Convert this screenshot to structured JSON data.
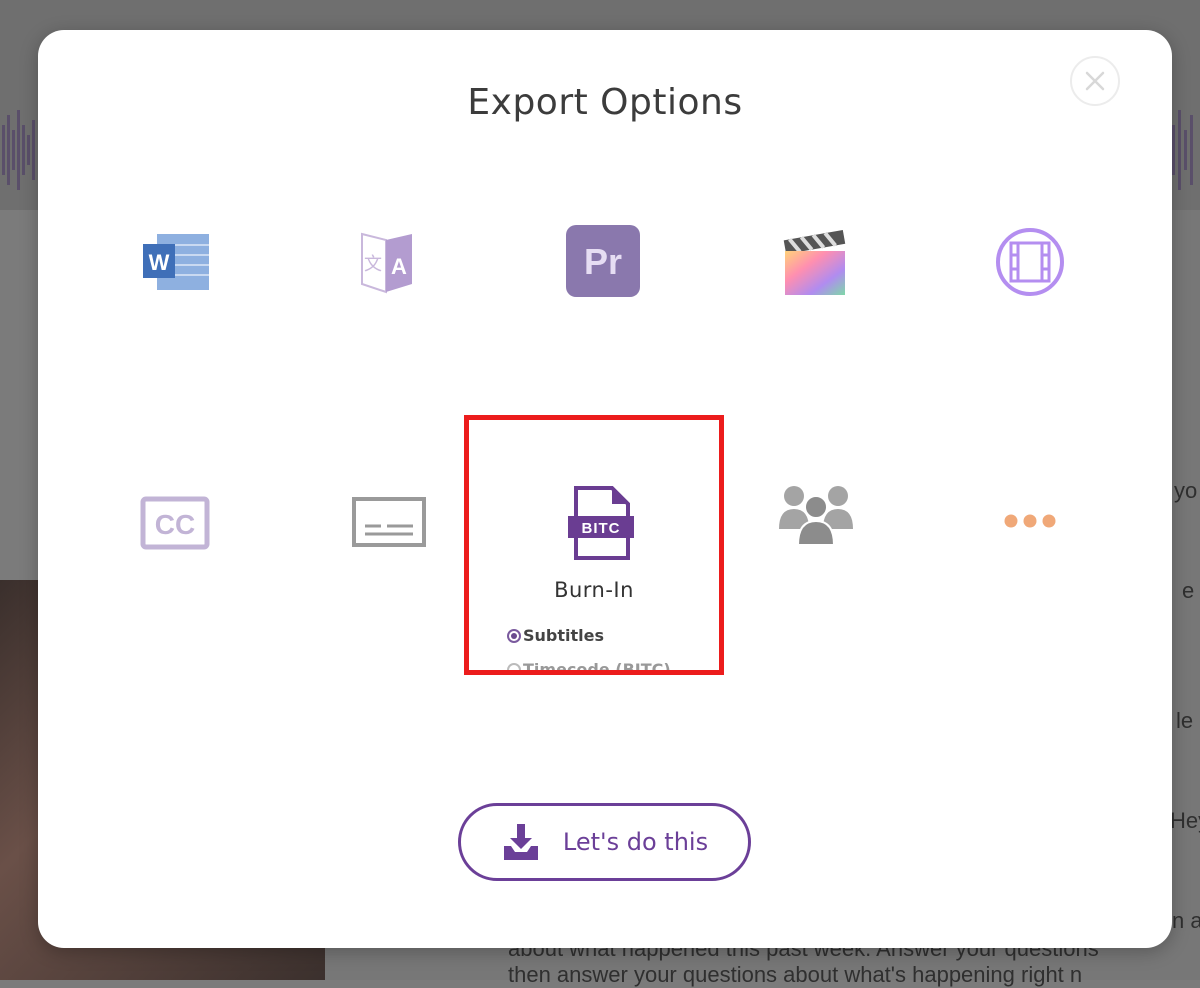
{
  "modal": {
    "title": "Export Options",
    "close_icon": "close-icon",
    "options_row1": [
      {
        "name": "word",
        "icon": "word-document-icon"
      },
      {
        "name": "translate",
        "icon": "translate-icon"
      },
      {
        "name": "premiere",
        "icon": "premiere-pro-icon",
        "icon_text": "Pr"
      },
      {
        "name": "final-cut",
        "icon": "final-cut-pro-icon"
      },
      {
        "name": "avid",
        "icon": "avid-film-icon"
      }
    ],
    "options_row2": [
      {
        "name": "closed-captions",
        "icon": "closed-captions-icon",
        "icon_text": "CC"
      },
      {
        "name": "subtitles",
        "icon": "subtitles-icon"
      },
      {
        "name": "burn-in",
        "icon": "burn-in-file-icon",
        "icon_text": "BITC",
        "selected": true
      },
      {
        "name": "speakers",
        "icon": "people-group-icon"
      },
      {
        "name": "more",
        "icon": "more-dots-icon"
      }
    ],
    "burn_in": {
      "label": "Burn-In",
      "radio_options": [
        {
          "label": "Subtitles",
          "checked": true
        },
        {
          "label": "Timecode (BITC)",
          "checked": false
        }
      ]
    },
    "action_button": {
      "label": "Let's do this",
      "icon": "download-tray-icon"
    }
  },
  "background": {
    "snippets": [
      "yo",
      "e",
      "le",
      "Hey",
      "n a",
      "about what happened this past week. Answer your questions",
      "then answer your questions about what's happening right n"
    ]
  },
  "colors": {
    "accent": "#6b3f98",
    "highlight": "#ec1c1c",
    "overlay": "#7b7b7b",
    "more_dots": "#f0a878"
  }
}
